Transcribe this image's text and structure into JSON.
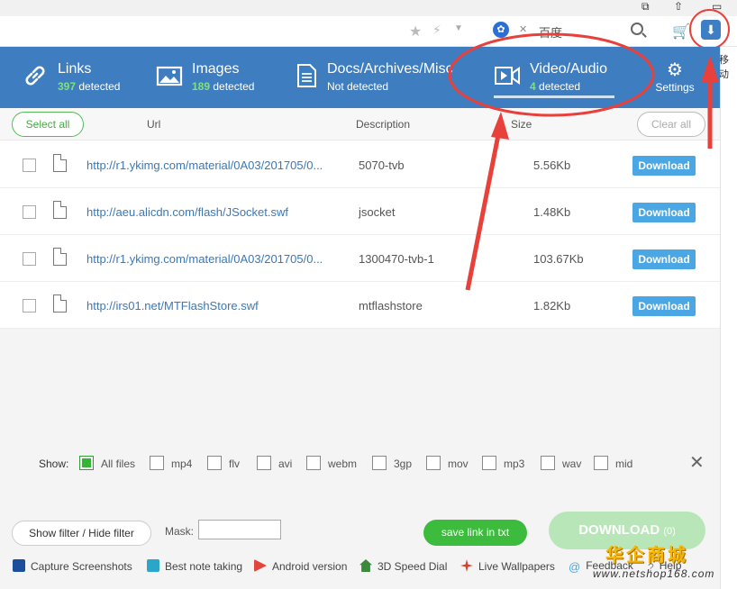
{
  "browser": {
    "baidu_label": "百度",
    "side_text": "移动"
  },
  "tabs": [
    {
      "title": "Links",
      "count": "397",
      "suffix": "detected",
      "icon": "link-icon"
    },
    {
      "title": "Images",
      "count": "189",
      "suffix": "detected",
      "icon": "image-icon"
    },
    {
      "title": "Docs/Archives/Misc",
      "sub": "Not detected",
      "icon": "document-icon"
    },
    {
      "title": "Video/Audio",
      "count": "4",
      "suffix": "detected",
      "icon": "video-icon",
      "active": true
    }
  ],
  "settings_label": "Settings",
  "header": {
    "select_all": "Select all",
    "col_url": "Url",
    "col_description": "Description",
    "col_size": "Size",
    "clear_all": "Clear all"
  },
  "rows": [
    {
      "url": "http://r1.ykimg.com/material/0A03/201705/0...",
      "description": "5070-tvb",
      "size": "5.56Kb",
      "action": "Download"
    },
    {
      "url": "http://aeu.alicdn.com/flash/JSocket.swf",
      "description": "jsocket",
      "size": "1.48Kb",
      "action": "Download"
    },
    {
      "url": "http://r1.ykimg.com/material/0A03/201705/0...",
      "description": "1300470-tvb-1",
      "size": "103.67Kb",
      "action": "Download"
    },
    {
      "url": "http://irs01.net/MTFlashStore.swf",
      "description": "mtflashstore",
      "size": "1.82Kb",
      "action": "Download"
    }
  ],
  "filters": {
    "show_label": "Show:",
    "items": [
      {
        "label": "All files",
        "checked": true
      },
      {
        "label": "mp4",
        "checked": false
      },
      {
        "label": "flv",
        "checked": false
      },
      {
        "label": "avi",
        "checked": false
      },
      {
        "label": "webm",
        "checked": false
      },
      {
        "label": "3gp",
        "checked": false
      },
      {
        "label": "mov",
        "checked": false
      },
      {
        "label": "mp3",
        "checked": false
      },
      {
        "label": "wav",
        "checked": false
      },
      {
        "label": "mid",
        "checked": false
      }
    ]
  },
  "bottom": {
    "show_filter": "Show filter / Hide filter",
    "mask_label": "Mask:",
    "mask_value": "",
    "save_link": "save link in txt",
    "download": "DOWNLOAD",
    "download_count": "(0)"
  },
  "footer": [
    {
      "label": "Capture Screenshots",
      "icon": "screenshot-icon",
      "color": "#1b4f9c"
    },
    {
      "label": "Best note taking",
      "icon": "note-icon",
      "color": "#2aa6c9"
    },
    {
      "label": "Android version",
      "icon": "play-store-icon",
      "color": "#e0463c"
    },
    {
      "label": "3D Speed Dial",
      "icon": "house-icon",
      "color": "#3b8a3b"
    },
    {
      "label": "Live Wallpapers",
      "icon": "pinwheel-icon",
      "color": "#d9402b"
    },
    {
      "label": "Feedback",
      "icon": "at-icon",
      "color": "#4aa7e3"
    },
    {
      "label": "Help",
      "icon": "help-icon",
      "color": "#888888"
    }
  ],
  "watermark": {
    "main": "华企商城",
    "sub": "www.netshop168.com"
  },
  "colors": {
    "header_blue": "#3e7dc0",
    "accent_green": "#3cbb3c",
    "download_blue": "#4aa7e3",
    "annotation_red": "#e8403a"
  }
}
